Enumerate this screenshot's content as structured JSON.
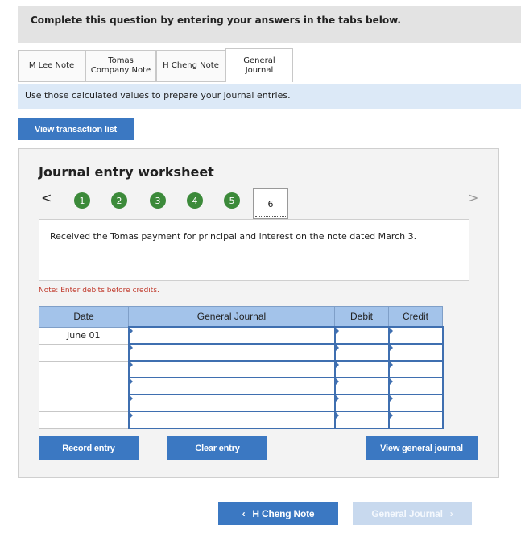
{
  "banner": {
    "text": "Complete this question by entering your answers in the tabs below."
  },
  "tabs": [
    {
      "line1": "M Lee Note",
      "line2": ""
    },
    {
      "line1": "Tomas",
      "line2": "Company Note"
    },
    {
      "line1": "H Cheng Note",
      "line2": ""
    },
    {
      "line1": "General",
      "line2": "Journal"
    }
  ],
  "instruction": "Use those calculated values to prepare your journal entries.",
  "view_transaction_label": "View transaction list",
  "worksheet": {
    "title": "Journal entry worksheet",
    "prev_arrow": "<",
    "next_arrow": ">",
    "steps": [
      "1",
      "2",
      "3",
      "4",
      "5"
    ],
    "active_step": "6",
    "description": "Received the Tomas payment for principal and interest on the note dated March 3.",
    "note": "Note: Enter debits before credits.",
    "headers": {
      "date": "Date",
      "general_journal": "General Journal",
      "debit": "Debit",
      "credit": "Credit"
    },
    "rows": [
      {
        "date": "June 01"
      },
      {
        "date": ""
      },
      {
        "date": ""
      },
      {
        "date": ""
      },
      {
        "date": ""
      },
      {
        "date": ""
      }
    ],
    "record_label": "Record entry",
    "clear_label": "Clear entry",
    "view_journal_label": "View general journal"
  },
  "bottom_nav": {
    "prev_label": "H Cheng Note",
    "prev_icon": "chevron-left-icon",
    "next_label": "General Journal",
    "next_icon": "chevron-right-icon"
  },
  "colors": {
    "primary": "#3b78c2",
    "step_done": "#3c8a3a",
    "disabled": "#c8d9ee",
    "note": "#c0392b"
  }
}
